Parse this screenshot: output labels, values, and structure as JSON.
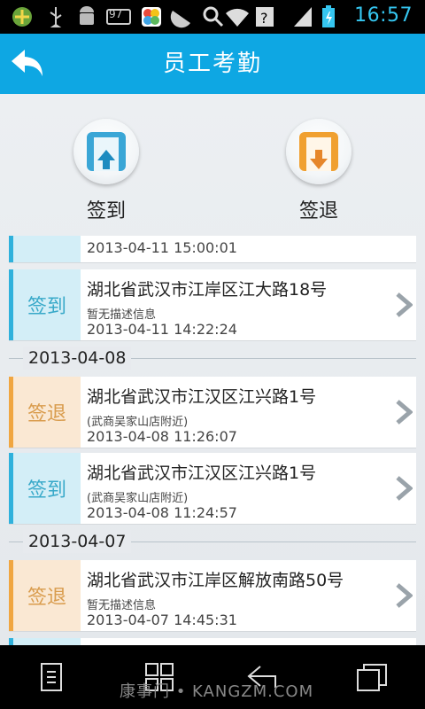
{
  "status_bar": {
    "time": "16:57",
    "battery_level": "97",
    "icons": [
      "app-icon",
      "usb-icon",
      "android-icon",
      "battery-97-icon",
      "gallery-icon",
      "watermelon-icon",
      "search-icon",
      "wifi-icon",
      "unknown-signal-icon",
      "signal-icon",
      "charging-battery-icon"
    ]
  },
  "header": {
    "title": "员工考勤",
    "back_icon": "back-arrow-icon"
  },
  "actions": {
    "sign_in_label": "签到",
    "sign_out_label": "签退"
  },
  "partial_top": {
    "time": "2013-04-11 15:00:01"
  },
  "records_group_0": [
    {
      "type_label": "签到",
      "address": "湖北省武汉市江岸区江大路18号",
      "desc": "暂无描述信息",
      "time": "2013-04-11 14:22:24"
    }
  ],
  "groups": [
    {
      "date": "2013-04-08",
      "records": [
        {
          "type_label": "签退",
          "address": "湖北省武汉市江汉区江兴路1号",
          "desc": "(武商吴家山店附近)",
          "time": "2013-04-08 11:26:07"
        },
        {
          "type_label": "签到",
          "address": "湖北省武汉市江汉区江兴路1号",
          "desc": "(武商吴家山店附近)",
          "time": "2013-04-08 11:24:57"
        }
      ]
    },
    {
      "date": "2013-04-07",
      "records": [
        {
          "type_label": "签退",
          "address": "湖北省武汉市江岸区解放南路50号",
          "desc": "暂无描述信息",
          "time": "2013-04-07 14:45:31"
        }
      ]
    }
  ],
  "nav": {
    "icons": [
      "menu-icon",
      "home-icon",
      "back-icon",
      "recent-apps-icon"
    ]
  },
  "watermark": "康事门 • KANGZM.COM",
  "colors": {
    "title_bar": "#0ea7e3",
    "sign_in": "#2fb1dc",
    "sign_out": "#f0a641",
    "time": "#35c6f0"
  }
}
